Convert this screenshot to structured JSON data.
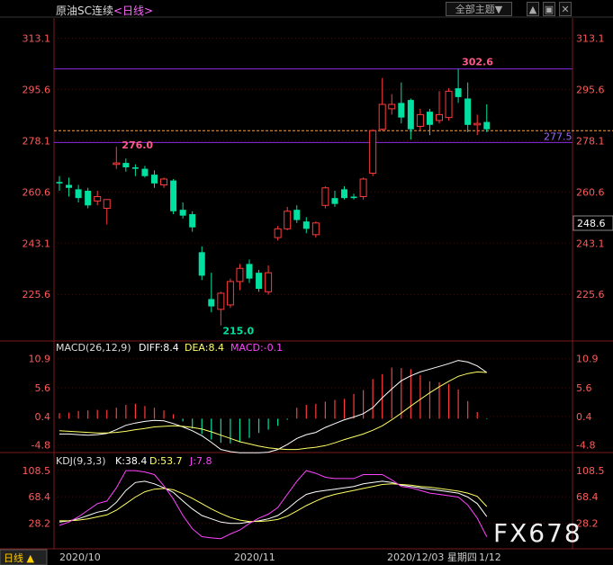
{
  "header": {
    "title": "原油SC连续",
    "period": "<日线>",
    "theme_button": "全部主题▼",
    "buttons": [
      "▲",
      "▣",
      "✕"
    ]
  },
  "price_axis_labels": [
    "313.1",
    "295.6",
    "278.1",
    "260.6",
    "243.1",
    "225.6"
  ],
  "annotations": {
    "high": "302.6",
    "low": "215.0",
    "left_peak": "276.0",
    "ref_price": "277.5",
    "last_price": "248.6"
  },
  "macd": {
    "label": "MACD(26,12,9)",
    "diff": "DIFF:8.4",
    "dea": "DEA:8.4",
    "macd": "MACD:-0.1",
    "axis_labels": [
      "10.9",
      "5.6",
      "0.4",
      "-4.8"
    ]
  },
  "kdj": {
    "label": "KDJ(9,3,3)",
    "k": "K:38.4",
    "d": "D:53.7",
    "j": "J:7.8",
    "axis_labels": [
      "108.5",
      "68.4",
      "28.2"
    ]
  },
  "bottom": {
    "period_tab": "日线",
    "dates": [
      "2020/10",
      "2020/11",
      "2020/12/03 星期四",
      "1/12"
    ]
  },
  "watermark": "FX678",
  "colors": {
    "up": "#ff3b3b",
    "down": "#00e0a0",
    "diff": "#ffffff",
    "dea": "#ffff66",
    "macd_label": "#ff44ff",
    "level_line": "#8a2be2",
    "ref_line": "#ffa040"
  },
  "chart_data": {
    "type": "candlestick",
    "y_range": [
      210,
      320
    ],
    "reference_lines": [
      302.6,
      281.5,
      277.5
    ],
    "candles": [
      {
        "o": 264.0,
        "h": 266.0,
        "l": 261.0,
        "c": 263.5
      },
      {
        "o": 263.0,
        "h": 265.5,
        "l": 259.0,
        "c": 262.0
      },
      {
        "o": 261.5,
        "h": 263.0,
        "l": 257.0,
        "c": 258.5
      },
      {
        "o": 261.0,
        "h": 262.0,
        "l": 255.0,
        "c": 256.0
      },
      {
        "o": 257.5,
        "h": 261.0,
        "l": 256.0,
        "c": 259.0
      },
      {
        "o": 255.0,
        "h": 258.0,
        "l": 249.5,
        "c": 258.0
      },
      {
        "o": 270.0,
        "h": 276.0,
        "l": 268.5,
        "c": 270.5
      },
      {
        "o": 270.5,
        "h": 272.0,
        "l": 267.5,
        "c": 269.0
      },
      {
        "o": 269.0,
        "h": 270.0,
        "l": 266.0,
        "c": 268.5
      },
      {
        "o": 268.5,
        "h": 269.5,
        "l": 265.5,
        "c": 266.0
      },
      {
        "o": 266.5,
        "h": 268.0,
        "l": 262.0,
        "c": 263.5
      },
      {
        "o": 263.0,
        "h": 265.5,
        "l": 262.0,
        "c": 265.0
      },
      {
        "o": 264.5,
        "h": 265.0,
        "l": 253.0,
        "c": 254.0
      },
      {
        "o": 254.5,
        "h": 257.0,
        "l": 251.5,
        "c": 252.5
      },
      {
        "o": 253.0,
        "h": 254.0,
        "l": 247.0,
        "c": 248.5
      },
      {
        "o": 240.0,
        "h": 242.0,
        "l": 230.5,
        "c": 232.0
      },
      {
        "o": 224.0,
        "h": 233.0,
        "l": 219.5,
        "c": 221.5
      },
      {
        "o": 220.5,
        "h": 226.5,
        "l": 215.0,
        "c": 226.0
      },
      {
        "o": 222.0,
        "h": 231.0,
        "l": 221.0,
        "c": 230.0
      },
      {
        "o": 230.0,
        "h": 236.0,
        "l": 227.0,
        "c": 234.5
      },
      {
        "o": 236.0,
        "h": 237.5,
        "l": 229.5,
        "c": 231.0
      },
      {
        "o": 233.0,
        "h": 234.0,
        "l": 226.5,
        "c": 227.5
      },
      {
        "o": 226.5,
        "h": 235.5,
        "l": 225.5,
        "c": 233.0
      },
      {
        "o": 245.0,
        "h": 249.0,
        "l": 244.0,
        "c": 248.0
      },
      {
        "o": 248.0,
        "h": 255.5,
        "l": 247.5,
        "c": 254.0
      },
      {
        "o": 254.5,
        "h": 256.0,
        "l": 250.0,
        "c": 251.0
      },
      {
        "o": 250.5,
        "h": 252.0,
        "l": 246.5,
        "c": 248.0
      },
      {
        "o": 246.0,
        "h": 250.5,
        "l": 245.0,
        "c": 250.0
      },
      {
        "o": 256.0,
        "h": 262.5,
        "l": 255.0,
        "c": 262.0
      },
      {
        "o": 258.5,
        "h": 261.0,
        "l": 255.5,
        "c": 256.5
      },
      {
        "o": 261.5,
        "h": 262.5,
        "l": 258.0,
        "c": 258.5
      },
      {
        "o": 259.0,
        "h": 260.0,
        "l": 258.0,
        "c": 258.5
      },
      {
        "o": 259.0,
        "h": 265.5,
        "l": 258.0,
        "c": 265.0
      },
      {
        "o": 267.0,
        "h": 282.0,
        "l": 266.0,
        "c": 281.5
      },
      {
        "o": 282.0,
        "h": 299.5,
        "l": 281.5,
        "c": 290.5
      },
      {
        "o": 289.0,
        "h": 294.0,
        "l": 287.0,
        "c": 290.5
      },
      {
        "o": 291.0,
        "h": 298.0,
        "l": 284.0,
        "c": 286.0
      },
      {
        "o": 292.0,
        "h": 292.5,
        "l": 278.5,
        "c": 282.0
      },
      {
        "o": 283.0,
        "h": 289.0,
        "l": 281.5,
        "c": 287.0
      },
      {
        "o": 288.0,
        "h": 289.0,
        "l": 280.0,
        "c": 283.5
      },
      {
        "o": 285.0,
        "h": 295.0,
        "l": 284.0,
        "c": 287.0
      },
      {
        "o": 286.0,
        "h": 296.0,
        "l": 285.0,
        "c": 295.0
      },
      {
        "o": 296.0,
        "h": 302.6,
        "l": 291.0,
        "c": 293.0
      },
      {
        "o": 292.5,
        "h": 298.0,
        "l": 281.0,
        "c": 283.5
      },
      {
        "o": 283.5,
        "h": 287.0,
        "l": 280.0,
        "c": 284.0
      },
      {
        "o": 284.5,
        "h": 290.5,
        "l": 281.0,
        "c": 282.0
      }
    ],
    "macd": {
      "y_range": [
        -6,
        12
      ],
      "diff": [
        -2.8,
        -2.8,
        -2.9,
        -3.0,
        -2.9,
        -2.7,
        -2.0,
        -1.2,
        -0.8,
        -0.5,
        -0.3,
        -0.4,
        -0.9,
        -1.5,
        -2.2,
        -3.1,
        -4.3,
        -5.6,
        -6.0,
        -6.2,
        -6.2,
        -6.2,
        -6.1,
        -5.6,
        -4.7,
        -3.6,
        -2.9,
        -2.5,
        -1.6,
        -0.9,
        -0.2,
        0.3,
        0.9,
        2.0,
        3.8,
        5.4,
        6.9,
        7.8,
        8.5,
        9.0,
        9.5,
        10.0,
        10.6,
        10.3,
        9.6,
        8.4
      ],
      "dea": [
        -2.2,
        -2.3,
        -2.4,
        -2.5,
        -2.6,
        -2.6,
        -2.5,
        -2.3,
        -2.0,
        -1.8,
        -1.5,
        -1.4,
        -1.3,
        -1.4,
        -1.6,
        -1.9,
        -2.4,
        -3.0,
        -3.6,
        -4.2,
        -4.6,
        -5.0,
        -5.3,
        -5.5,
        -5.6,
        -5.6,
        -5.4,
        -5.2,
        -4.9,
        -4.4,
        -3.8,
        -3.3,
        -2.8,
        -2.1,
        -1.3,
        -0.2,
        1.0,
        2.3,
        3.5,
        4.7,
        5.8,
        6.8,
        7.7,
        8.2,
        8.5,
        8.4
      ],
      "hist": [
        1.0,
        1.1,
        1.4,
        1.5,
        1.6,
        1.6,
        2.0,
        2.5,
        2.7,
        2.3,
        2.0,
        1.5,
        0.8,
        -0.5,
        -1.8,
        -2.8,
        -3.8,
        -4.4,
        -4.5,
        -4.3,
        -3.5,
        -2.6,
        -2.0,
        -1.3,
        -0.2,
        2.0,
        2.5,
        2.7,
        3.1,
        3.4,
        3.6,
        4.5,
        5.2,
        7.2,
        8.1,
        9.3,
        9.2,
        9.0,
        7.9,
        6.8,
        6.6,
        6.3,
        5.3,
        3.2,
        1.2,
        -0.1
      ]
    },
    "kdj": {
      "y_range": [
        -5,
        115
      ],
      "k": [
        30,
        32,
        35,
        40,
        45,
        48,
        60,
        78,
        90,
        92,
        88,
        82,
        75,
        62,
        50,
        40,
        35,
        30,
        28,
        28,
        30,
        32,
        35,
        40,
        50,
        62,
        72,
        76,
        78,
        80,
        82,
        84,
        88,
        90,
        92,
        90,
        86,
        84,
        82,
        80,
        78,
        76,
        74,
        68,
        58,
        38.4
      ],
      "d": [
        32,
        32,
        33,
        35,
        38,
        41,
        48,
        58,
        68,
        76,
        80,
        81,
        79,
        73,
        66,
        58,
        50,
        43,
        37,
        33,
        31,
        31,
        32,
        34,
        39,
        47,
        55,
        62,
        68,
        72,
        75,
        78,
        81,
        84,
        87,
        88,
        87,
        86,
        84,
        83,
        81,
        79,
        77,
        74,
        69,
        53.7
      ],
      "j": [
        25,
        30,
        38,
        48,
        58,
        62,
        82,
        108,
        108,
        106,
        102,
        85,
        65,
        40,
        20,
        8,
        6,
        5,
        12,
        18,
        28,
        36,
        42,
        52,
        72,
        92,
        108,
        104,
        98,
        96,
        96,
        96,
        102,
        102,
        102,
        94,
        84,
        82,
        78,
        74,
        72,
        70,
        68,
        56,
        36,
        7.8
      ]
    }
  }
}
